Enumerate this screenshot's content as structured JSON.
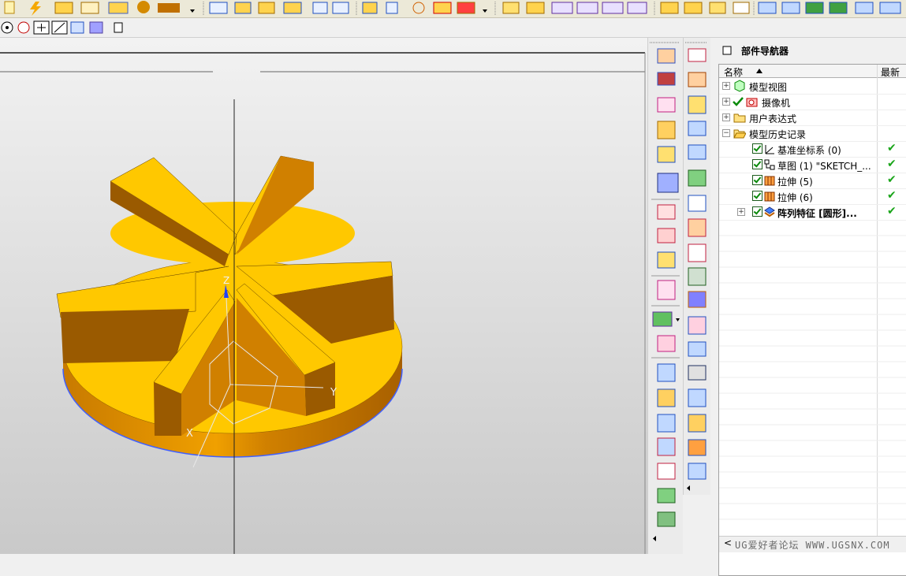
{
  "navigator": {
    "title": "部件导航器",
    "columns": {
      "name": "名称",
      "latest": "最新"
    },
    "rows": [
      {
        "label": "模型视图",
        "status": ""
      },
      {
        "label": "摄像机",
        "status": ""
      },
      {
        "label": "用户表达式",
        "status": ""
      },
      {
        "label": "模型历史记录",
        "status": ""
      },
      {
        "label": "基准坐标系 (0)",
        "status": "✔"
      },
      {
        "label": "草图 (1) \"SKETCH_...",
        "status": "✔"
      },
      {
        "label": "拉伸 (5)",
        "status": "✔"
      },
      {
        "label": "拉伸 (6)",
        "status": "✔"
      },
      {
        "label": "阵列特征 [圆形]...",
        "status": "✔"
      }
    ],
    "expanders": {
      "plus": "+",
      "minus": "−"
    }
  },
  "axes": {
    "x": "X",
    "y": "Y",
    "z": "Z"
  },
  "watermark": "UG爱好者论坛 WWW.UGSNX.COM",
  "scroll_arrow": "<",
  "colors": {
    "part_top": "#FFC800",
    "part_side": "#D08000",
    "part_dark": "#9A5A00",
    "edge": "#4060ff",
    "check": "#1aa51a"
  }
}
